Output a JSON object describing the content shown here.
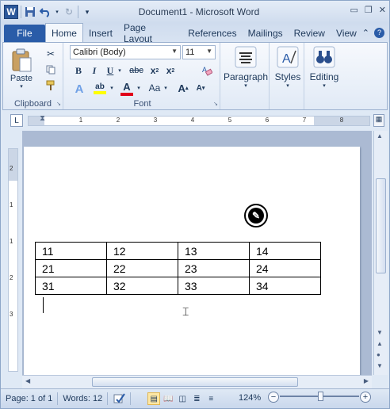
{
  "window": {
    "title": "Document1 - Microsoft Word"
  },
  "tabs": {
    "file": "File",
    "home": "Home",
    "insert": "Insert",
    "page_layout": "Page Layout",
    "references": "References",
    "mailings": "Mailings",
    "review": "Review",
    "view": "View"
  },
  "ribbon": {
    "clipboard": {
      "label": "Clipboard",
      "paste": "Paste"
    },
    "font": {
      "label": "Font",
      "name": "Calibri (Body)",
      "size": "11"
    },
    "paragraph": {
      "label": "Paragraph"
    },
    "styles": {
      "label": "Styles"
    },
    "editing": {
      "label": "Editing"
    }
  },
  "ruler": {
    "numbers": [
      "1",
      "2",
      "3",
      "4",
      "5",
      "6",
      "7",
      "8"
    ]
  },
  "vruler": {
    "numbers": [
      "2",
      "1",
      "1",
      "2",
      "3"
    ]
  },
  "table": {
    "rows": [
      [
        "11",
        "12",
        "13",
        "14"
      ],
      [
        "21",
        "22",
        "23",
        "24"
      ],
      [
        "31",
        "32",
        "33",
        "34"
      ]
    ]
  },
  "status": {
    "page": "Page: 1 of 1",
    "words": "Words: 12",
    "zoom": "124%",
    "zoom_level_percent": 124
  }
}
